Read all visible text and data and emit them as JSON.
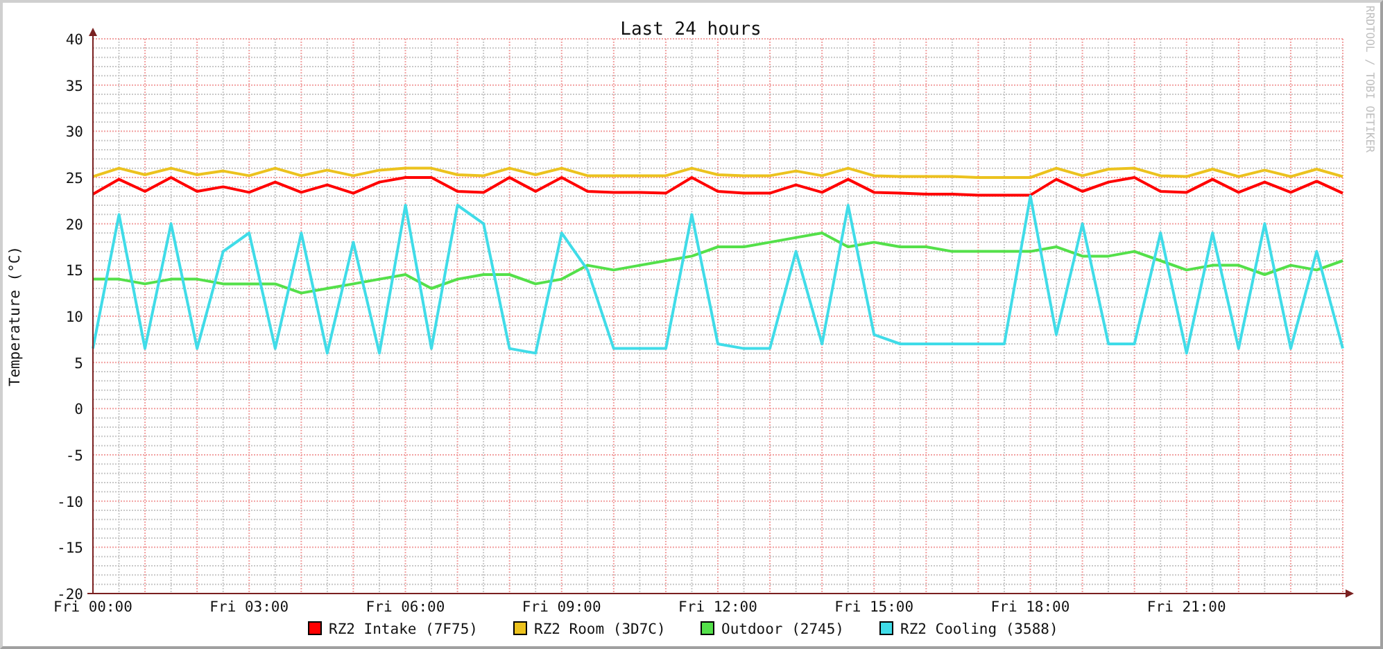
{
  "graph": {
    "side_label": "RRDTOOL / TOBI OETIKER",
    "chart_data": {
      "type": "line",
      "title": "Last 24 hours",
      "ylabel": "Temperature (°C)",
      "categories": [
        "Fri 00:00",
        null,
        null,
        null,
        null,
        null,
        "Fri 03:00",
        null,
        null,
        null,
        null,
        null,
        "Fri 06:00",
        null,
        null,
        null,
        null,
        null,
        "Fri 09:00",
        null,
        null,
        null,
        null,
        null,
        "Fri 12:00",
        null,
        null,
        null,
        null,
        null,
        "Fri 15:00",
        null,
        null,
        null,
        null,
        null,
        "Fri 18:00",
        null,
        null,
        null,
        null,
        null,
        "Fri 21:00",
        null,
        null,
        null,
        null,
        null,
        null
      ],
      "ylim": [
        -20,
        40
      ],
      "grid": true,
      "legend": "bottom",
      "yticks": [
        -20,
        -15,
        -10,
        -5,
        0,
        5,
        10,
        15,
        20,
        25,
        30,
        35,
        40
      ],
      "series": [
        {
          "name": "RZ2 Intake (7F75)",
          "color": "#ff0000",
          "values": [
            23.2,
            24.8,
            23.5,
            25,
            23.5,
            24,
            23.4,
            24.5,
            23.4,
            24.2,
            23.3,
            24.5,
            25,
            25,
            23.5,
            23.4,
            25,
            23.5,
            25,
            23.5,
            23.4,
            23.4,
            23.3,
            25,
            23.5,
            23.3,
            23.3,
            24.2,
            23.4,
            24.8,
            23.4,
            23.3,
            23.2,
            23.2,
            23.1,
            23.1,
            23.1,
            24.8,
            23.5,
            24.5,
            25,
            23.5,
            23.4,
            24.8,
            23.4,
            24.5,
            23.4,
            24.6,
            23.3
          ]
        },
        {
          "name": "RZ2 Room (3D7C)",
          "color": "#ecc21e",
          "values": [
            25.1,
            26,
            25.3,
            26,
            25.3,
            25.7,
            25.2,
            26,
            25.2,
            25.8,
            25.2,
            25.8,
            26,
            26,
            25.3,
            25.2,
            26,
            25.3,
            26,
            25.2,
            25.2,
            25.2,
            25.2,
            26,
            25.3,
            25.2,
            25.2,
            25.7,
            25.2,
            26,
            25.2,
            25.1,
            25.1,
            25.1,
            25,
            25,
            25,
            26,
            25.2,
            25.9,
            26,
            25.2,
            25.1,
            25.9,
            25.1,
            25.8,
            25.1,
            25.9,
            25.1
          ]
        },
        {
          "name": "Outdoor (2745)",
          "color": "#54e04a",
          "values": [
            14,
            14,
            13.5,
            14,
            14,
            13.5,
            13.5,
            13.5,
            12.5,
            13,
            13.5,
            14,
            14.5,
            13,
            14,
            14.5,
            14.5,
            13.5,
            14,
            15.5,
            15,
            15.5,
            16,
            16.5,
            17.5,
            17.5,
            18,
            18.5,
            19,
            17.5,
            18,
            17.5,
            17.5,
            17,
            17,
            17,
            17,
            17.5,
            16.5,
            16.5,
            17,
            16,
            15,
            15.5,
            15.5,
            14.5,
            15.5,
            15,
            16
          ]
        },
        {
          "name": "RZ2 Cooling (3588)",
          "color": "#40dce8",
          "values": [
            6.5,
            21,
            6.5,
            20,
            6.5,
            17,
            19,
            6.5,
            19,
            6,
            18,
            6,
            22,
            6.5,
            22,
            20,
            6.5,
            6,
            19,
            15,
            6.5,
            6.5,
            6.5,
            21,
            7,
            6.5,
            6.5,
            17,
            7,
            22,
            8,
            7,
            7,
            7,
            7,
            7,
            23,
            8,
            20,
            7,
            7,
            19,
            6,
            19,
            6.5,
            20,
            6.5,
            17,
            6.5
          ]
        }
      ]
    }
  }
}
